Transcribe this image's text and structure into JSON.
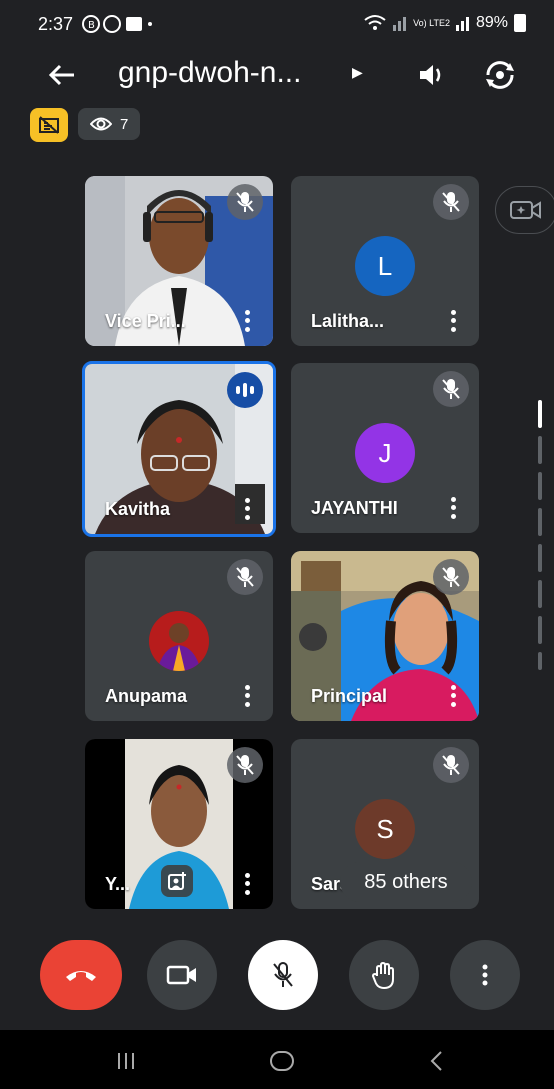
{
  "status_bar": {
    "time": "2:37",
    "battery": "89%",
    "network_label": "Vo) LTE2"
  },
  "header": {
    "title": "gnp-dwoh-n...",
    "viewer_count": "7"
  },
  "tiles": [
    {
      "name": "Vice Pri...",
      "muted": true,
      "video": true
    },
    {
      "name": "Lalitha...",
      "muted": true,
      "avatar_letter": "L",
      "avatar_color": "#1565c0"
    },
    {
      "name": "Kavitha",
      "speaking": true,
      "video": true
    },
    {
      "name": "JAYANTHI",
      "muted": true,
      "avatar_letter": "J",
      "avatar_color": "#9334e6"
    },
    {
      "name": "Anupama",
      "muted": true,
      "photo_avatar": true
    },
    {
      "name": "Principal",
      "muted": true,
      "video": true
    },
    {
      "name": "Y...",
      "muted": true,
      "video": true
    },
    {
      "name": "Sara",
      "muted": true,
      "avatar_letter": "S",
      "avatar_color": "#6d3a2a"
    }
  ],
  "others_label": "85 others",
  "colors": {
    "end_call": "#ea4335",
    "nocam_chip": "#f6c026",
    "speaking": "#1a73e8"
  }
}
